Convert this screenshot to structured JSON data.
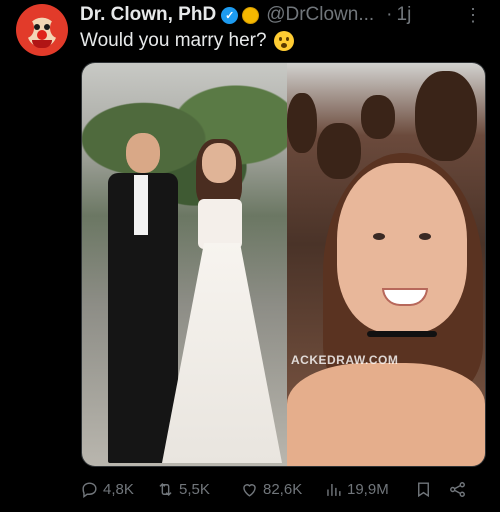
{
  "author": {
    "display_name": "Dr. Clown, PhD",
    "handle": "@DrClown...",
    "separator": "·",
    "time": "1j",
    "verified_icon": "verified-badge-icon",
    "affiliate_icon": "gold-badge-icon"
  },
  "post": {
    "text": "Would you marry her?",
    "emoji_icon": "flushed-face-icon",
    "media_watermark": "ACKEDRAW.COM"
  },
  "actions": {
    "replies": "4,8K",
    "reposts": "5,5K",
    "likes": "82,6K",
    "views": "19,9M"
  },
  "colors": {
    "background": "#000000",
    "text": "#e7e9ea",
    "muted": "#71767b",
    "verified": "#1d9bf0",
    "gold": "#f5b800"
  }
}
